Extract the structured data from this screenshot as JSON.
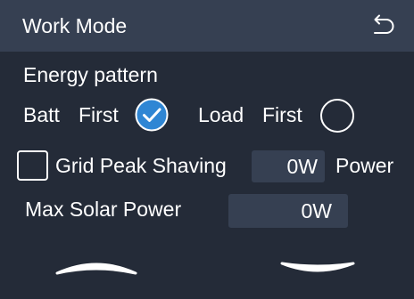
{
  "header": {
    "title": "Work Mode",
    "back_icon": "return-arrow-icon"
  },
  "energy_pattern": {
    "label": "Energy pattern",
    "options": [
      {
        "word1": "Batt",
        "word2": "First",
        "selected": true
      },
      {
        "word1": "Load",
        "word2": "First",
        "selected": false
      }
    ]
  },
  "grid_peak_shaving": {
    "checked": false,
    "label": "Grid Peak Shaving",
    "value": "0W",
    "suffix": "Power"
  },
  "max_solar_power": {
    "label": "Max Solar Power",
    "value": "0W"
  },
  "navigation": {
    "up_icon": "chevron-up-icon",
    "down_icon": "chevron-down-icon"
  },
  "colors": {
    "background": "#242b38",
    "header": "#364052",
    "field": "#364052",
    "accent": "#2f86d4",
    "text": "#ffffff"
  }
}
